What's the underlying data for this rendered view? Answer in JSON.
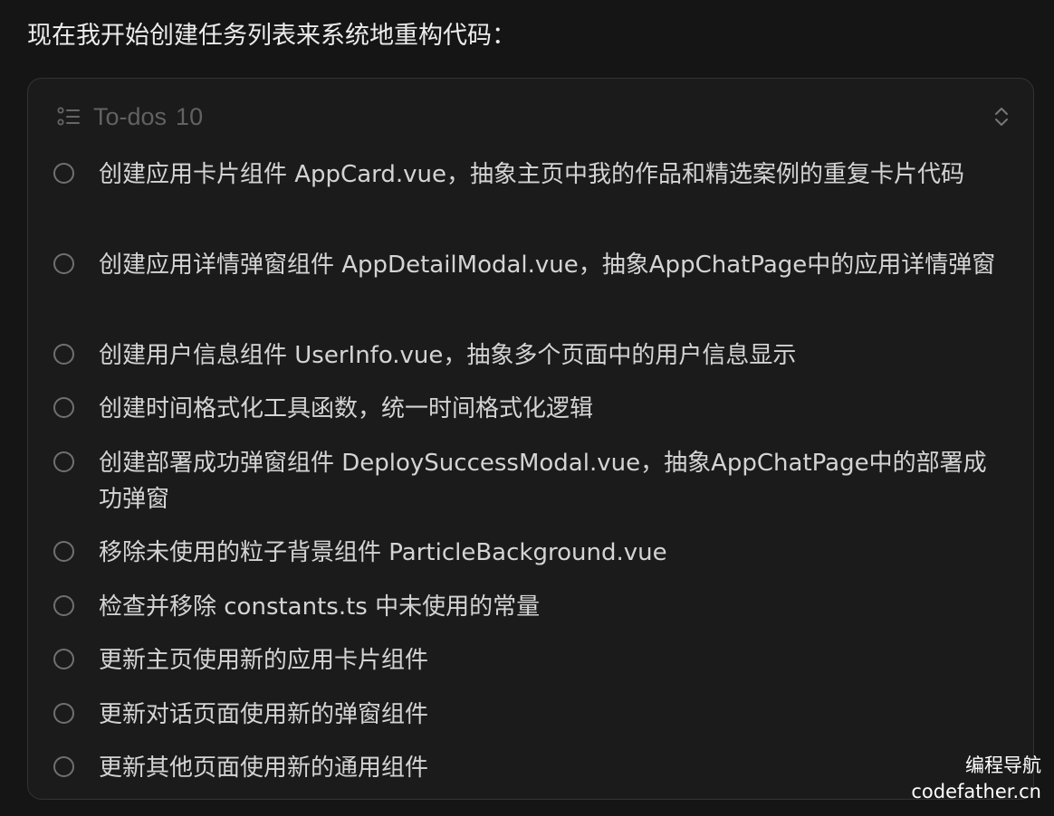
{
  "intro": "现在我开始创建任务列表来系统地重构代码：",
  "todos": {
    "title": "To-dos",
    "count": "10",
    "header_icon": "list-icon",
    "collapse_icon": "chevron-up-down-icon",
    "items": [
      {
        "text": "创建应用卡片组件 AppCard.vue，抽象主页中我的作品和精选案例的重复卡片代码",
        "done": false
      },
      {
        "text": "创建应用详情弹窗组件 AppDetailModal.vue，抽象AppChatPage中的应用详情弹窗",
        "done": false
      },
      {
        "text": "创建用户信息组件 UserInfo.vue，抽象多个页面中的用户信息显示",
        "done": false
      },
      {
        "text": "创建时间格式化工具函数，统一时间格式化逻辑",
        "done": false
      },
      {
        "text": "创建部署成功弹窗组件 DeploySuccessModal.vue，抽象AppChatPage中的部署成功弹窗",
        "done": false
      },
      {
        "text": "移除未使用的粒子背景组件 ParticleBackground.vue",
        "done": false
      },
      {
        "text": "检查并移除 constants.ts 中未使用的常量",
        "done": false
      },
      {
        "text": "更新主页使用新的应用卡片组件",
        "done": false
      },
      {
        "text": "更新对话页面使用新的弹窗组件",
        "done": false
      },
      {
        "text": "更新其他页面使用新的通用组件",
        "done": false
      }
    ]
  },
  "watermark": {
    "line1": "编程导航",
    "line2": "codefather.cn"
  }
}
